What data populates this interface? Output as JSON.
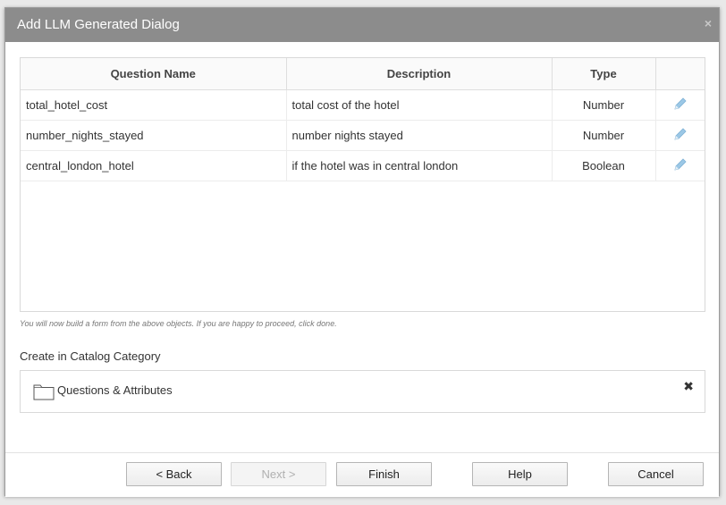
{
  "dialog": {
    "title": "Add LLM Generated Dialog",
    "close_symbol": "×"
  },
  "table": {
    "headers": {
      "name": "Question Name",
      "description": "Description",
      "type": "Type",
      "actions": ""
    },
    "rows": [
      {
        "name": "total_hotel_cost",
        "description": "total cost of the hotel",
        "type": "Number",
        "action_icon": "pencil-icon"
      },
      {
        "name": "number_nights_stayed",
        "description": "number nights stayed",
        "type": "Number",
        "action_icon": "pencil-icon"
      },
      {
        "name": "central_london_hotel",
        "description": "if the hotel was in central london",
        "type": "Boolean",
        "action_icon": "pencil-icon"
      }
    ]
  },
  "note": "You will now build a form from the above objects. If you are happy to proceed, click done.",
  "catalog": {
    "label": "Create in Catalog Category",
    "value": "Questions & Attributes",
    "icon": "folder-icon",
    "remove_symbol": "✖"
  },
  "buttons": {
    "back": "< Back",
    "next": "Next >",
    "finish": "Finish",
    "help": "Help",
    "cancel": "Cancel"
  },
  "colors": {
    "titlebar": "#8c8c8c",
    "pencil": "#8fbfe0"
  }
}
